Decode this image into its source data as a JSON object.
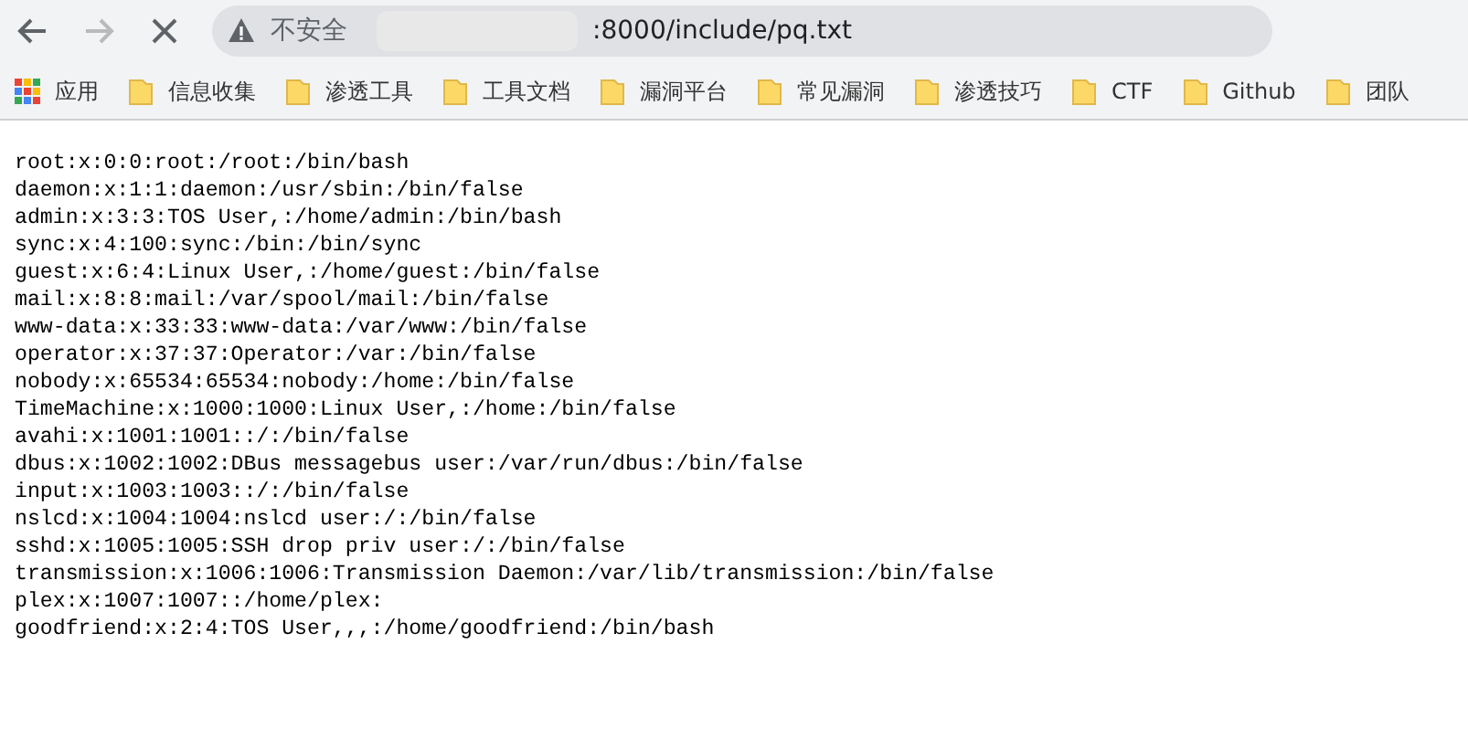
{
  "toolbar": {
    "security_label": "不安全",
    "url": ":8000/include/pq.txt"
  },
  "bookmarks": [
    {
      "label": "应用",
      "kind": "apps"
    },
    {
      "label": "信息收集",
      "kind": "folder"
    },
    {
      "label": "渗透工具",
      "kind": "folder"
    },
    {
      "label": "工具文档",
      "kind": "folder"
    },
    {
      "label": "漏洞平台",
      "kind": "folder"
    },
    {
      "label": "常见漏洞",
      "kind": "folder"
    },
    {
      "label": "渗透技巧",
      "kind": "folder"
    },
    {
      "label": "CTF",
      "kind": "folder"
    },
    {
      "label": "Github",
      "kind": "folder"
    },
    {
      "label": "团队",
      "kind": "folder"
    }
  ],
  "file_lines": [
    "root:x:0:0:root:/root:/bin/bash",
    "daemon:x:1:1:daemon:/usr/sbin:/bin/false",
    "admin:x:3:3:TOS User,:/home/admin:/bin/bash",
    "sync:x:4:100:sync:/bin:/bin/sync",
    "guest:x:6:4:Linux User,:/home/guest:/bin/false",
    "mail:x:8:8:mail:/var/spool/mail:/bin/false",
    "www-data:x:33:33:www-data:/var/www:/bin/false",
    "operator:x:37:37:Operator:/var:/bin/false",
    "nobody:x:65534:65534:nobody:/home:/bin/false",
    "TimeMachine:x:1000:1000:Linux User,:/home:/bin/false",
    "avahi:x:1001:1001::/:/bin/false",
    "dbus:x:1002:1002:DBus messagebus user:/var/run/dbus:/bin/false",
    "input:x:1003:1003::/:/bin/false",
    "nslcd:x:1004:1004:nslcd user:/:/bin/false",
    "sshd:x:1005:1005:SSH drop priv user:/:/bin/false",
    "transmission:x:1006:1006:Transmission Daemon:/var/lib/transmission:/bin/false",
    "plex:x:1007:1007::/home/plex:",
    "goodfriend:x:2:4:TOS User,,,:/home/goodfriend:/bin/bash"
  ]
}
